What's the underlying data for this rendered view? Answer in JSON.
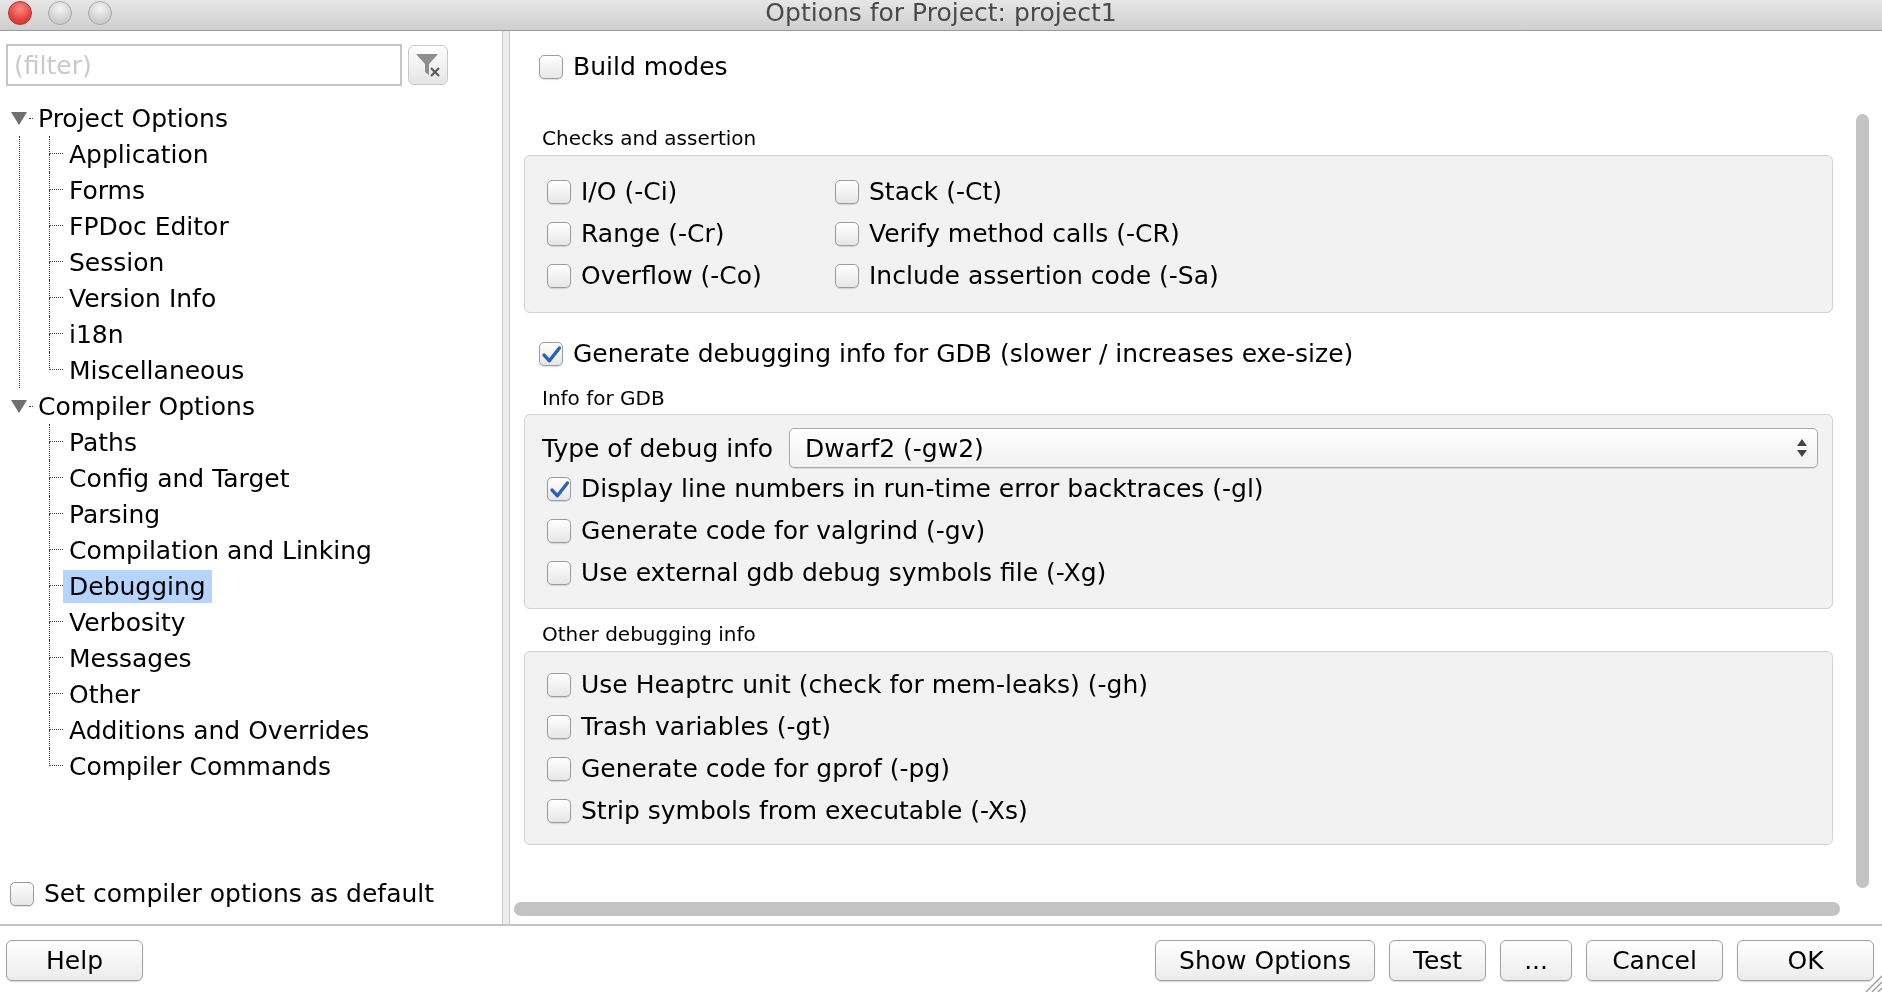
{
  "window": {
    "title": "Options for Project: project1"
  },
  "filter": {
    "placeholder": "(filter)"
  },
  "tree": [
    {
      "label": "Project Options",
      "expanded": true,
      "selected": false,
      "children": [
        {
          "label": "Application",
          "selected": false
        },
        {
          "label": "Forms",
          "selected": false
        },
        {
          "label": "FPDoc Editor",
          "selected": false
        },
        {
          "label": "Session",
          "selected": false
        },
        {
          "label": "Version Info",
          "selected": false
        },
        {
          "label": "i18n",
          "selected": false
        },
        {
          "label": "Miscellaneous",
          "selected": false
        }
      ]
    },
    {
      "label": "Compiler Options",
      "expanded": true,
      "selected": false,
      "children": [
        {
          "label": "Paths",
          "selected": false
        },
        {
          "label": "Config and Target",
          "selected": false
        },
        {
          "label": "Parsing",
          "selected": false
        },
        {
          "label": "Compilation and Linking",
          "selected": false
        },
        {
          "label": "Debugging",
          "selected": true
        },
        {
          "label": "Verbosity",
          "selected": false
        },
        {
          "label": "Messages",
          "selected": false
        },
        {
          "label": "Other",
          "selected": false
        },
        {
          "label": "Additions and Overrides",
          "selected": false
        },
        {
          "label": "Compiler Commands",
          "selected": false
        }
      ]
    }
  ],
  "set_default": {
    "label": "Set compiler options as default",
    "checked": false
  },
  "build_modes": {
    "label": "Build modes",
    "checked": false
  },
  "checks": {
    "title": "Checks and assertion",
    "options": [
      {
        "label": "I/O (-Ci)",
        "checked": false
      },
      {
        "label": "Stack (-Ct)",
        "checked": false
      },
      {
        "label": "Range (-Cr)",
        "checked": false
      },
      {
        "label": "Verify method calls (-CR)",
        "checked": false
      },
      {
        "label": "Overflow (-Co)",
        "checked": false
      },
      {
        "label": "Include assertion code (-Sa)",
        "checked": false
      }
    ]
  },
  "gdb_info": {
    "label": "Generate debugging info for GDB (slower / increases exe-size)",
    "checked": true
  },
  "gdb_group": {
    "title": "Info for GDB",
    "debug_type": {
      "label": "Type of debug info",
      "value": "Dwarf2 (-gw2)"
    },
    "options": [
      {
        "label": "Display line numbers in run-time error backtraces (-gl)",
        "checked": true
      },
      {
        "label": "Generate code for valgrind (-gv)",
        "checked": false
      },
      {
        "label": "Use external gdb debug symbols file (-Xg)",
        "checked": false
      }
    ]
  },
  "other_group": {
    "title": "Other debugging info",
    "options": [
      {
        "label": "Use Heaptrc unit (check for mem-leaks) (-gh)",
        "checked": false
      },
      {
        "label": "Trash variables (-gt)",
        "checked": false
      },
      {
        "label": "Generate code for gprof (-pg)",
        "checked": false
      },
      {
        "label": "Strip symbols from executable (-Xs)",
        "checked": false
      }
    ]
  },
  "buttons": {
    "help": "Help",
    "actions": [
      "Show Options",
      "Test",
      "..."
    ],
    "dialog": [
      "Cancel",
      "OK"
    ]
  }
}
